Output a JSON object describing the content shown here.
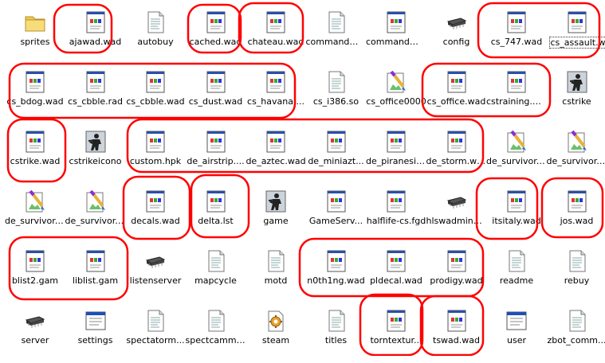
{
  "folder": {
    "items": [
      {
        "label": "sprites",
        "icon": "folder"
      },
      {
        "label": "ajawad.wad",
        "icon": "doc"
      },
      {
        "label": "autobuy",
        "icon": "text"
      },
      {
        "label": "cached.wad",
        "icon": "doc"
      },
      {
        "label": "chateau.wad",
        "icon": "doc"
      },
      {
        "label": "commandmenu",
        "icon": "text"
      },
      {
        "label": "commandme...",
        "icon": "doc"
      },
      {
        "label": "config",
        "icon": "chip"
      },
      {
        "label": "cs_747.wad",
        "icon": "doc"
      },
      {
        "label": "cs_assault.wad",
        "icon": "doc",
        "selected": true
      },
      {
        "label": "cs_bdog.wad",
        "icon": "doc"
      },
      {
        "label": "cs_cbble.rad",
        "icon": "doc"
      },
      {
        "label": "cs_cbble.wad",
        "icon": "doc"
      },
      {
        "label": "cs_dust.wad",
        "icon": "doc"
      },
      {
        "label": "cs_havana....",
        "icon": "doc"
      },
      {
        "label": "cs_i386.so",
        "icon": "text"
      },
      {
        "label": "cs_office0000",
        "icon": "paint"
      },
      {
        "label": "cs_office.wad",
        "icon": "doc"
      },
      {
        "label": "cstraining.wad",
        "icon": "doc"
      },
      {
        "label": "cstrike",
        "icon": "soldier"
      },
      {
        "label": "cstrike.wad",
        "icon": "doc"
      },
      {
        "label": "cstrikeicono",
        "icon": "soldier"
      },
      {
        "label": "custom.hpk",
        "icon": "doc"
      },
      {
        "label": "de_airstrip....",
        "icon": "doc"
      },
      {
        "label": "de_aztec.wad",
        "icon": "doc"
      },
      {
        "label": "de_miniazt...",
        "icon": "doc"
      },
      {
        "label": "de_piranesi....",
        "icon": "doc"
      },
      {
        "label": "de_storm.wad",
        "icon": "doc"
      },
      {
        "label": "de_survivor....",
        "icon": "paint"
      },
      {
        "label": "de_survivor....",
        "icon": "paint"
      },
      {
        "label": "de_survivor....",
        "icon": "paint"
      },
      {
        "label": "de_survivor....",
        "icon": "paint"
      },
      {
        "label": "decals.wad",
        "icon": "doc"
      },
      {
        "label": "delta.lst",
        "icon": "doc"
      },
      {
        "label": "game",
        "icon": "soldier"
      },
      {
        "label": "GameServ...",
        "icon": "doc"
      },
      {
        "label": "halflife-cs.fgd",
        "icon": "doc"
      },
      {
        "label": "hlswadminmod",
        "icon": "chip"
      },
      {
        "label": "itsitaly.wad",
        "icon": "doc"
      },
      {
        "label": "jos.wad",
        "icon": "doc"
      },
      {
        "label": "blist2.gam",
        "icon": "doc"
      },
      {
        "label": "liblist.gam",
        "icon": "doc"
      },
      {
        "label": "listenserver",
        "icon": "chip"
      },
      {
        "label": "mapcycle",
        "icon": "text"
      },
      {
        "label": "motd",
        "icon": "text"
      },
      {
        "label": "n0th1ng.wad",
        "icon": "doc"
      },
      {
        "label": "pldecal.wad",
        "icon": "doc"
      },
      {
        "label": "prodigy.wad",
        "icon": "doc"
      },
      {
        "label": "readme",
        "icon": "text"
      },
      {
        "label": "rebuy",
        "icon": "text"
      },
      {
        "label": "server",
        "icon": "chip"
      },
      {
        "label": "settings",
        "icon": "window"
      },
      {
        "label": "spectatorm...",
        "icon": "text"
      },
      {
        "label": "spectcammenu",
        "icon": "text"
      },
      {
        "label": "steam",
        "icon": "steam"
      },
      {
        "label": "titles",
        "icon": "text"
      },
      {
        "label": "torntextur...",
        "icon": "doc"
      },
      {
        "label": "tswad.wad",
        "icon": "doc"
      },
      {
        "label": "user",
        "icon": "window"
      },
      {
        "label": "zbot_comm...",
        "icon": "text"
      }
    ]
  },
  "colors": {
    "highlight_marker": "#ff0000",
    "label_text": "#000000",
    "background": "#ffffff"
  }
}
